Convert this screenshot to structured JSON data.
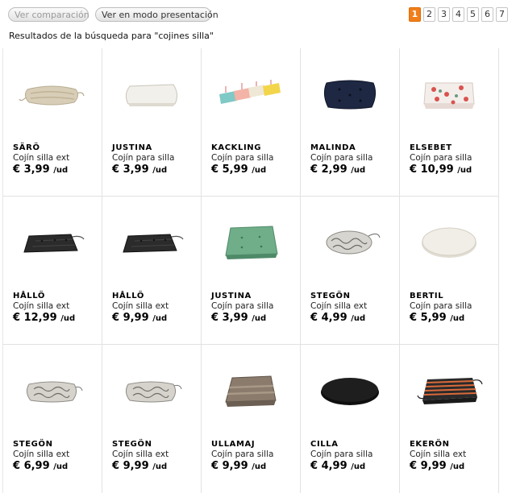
{
  "toolbar": {
    "compare_label": "Ver comparación",
    "present_label": "Ver en modo presentación"
  },
  "pagination": {
    "current": "1",
    "pages": [
      "1",
      "2",
      "3",
      "4",
      "5",
      "6",
      "7"
    ]
  },
  "results_text": "Resultados de la búsqueda para \"cojines silla\"",
  "products": [
    {
      "name": "SÄRÖ",
      "desc": "Cojín silla ext",
      "price": "€ 3,99",
      "unit": "/ud",
      "icon": "beige-striped-cushion"
    },
    {
      "name": "JUSTINA",
      "desc": "Cojín para silla",
      "price": "€ 3,99",
      "unit": "/ud",
      "icon": "white-cushion"
    },
    {
      "name": "KACKLING",
      "desc": "Cojín para silla",
      "price": "€ 5,99",
      "unit": "/ud",
      "icon": "multicolor-cushions"
    },
    {
      "name": "MALINDA",
      "desc": "Cojín para silla",
      "price": "€ 2,99",
      "unit": "/ud",
      "icon": "navy-cushion"
    },
    {
      "name": "ELSEBET",
      "desc": "Cojín para silla",
      "price": "€ 10,99",
      "unit": "/ud",
      "icon": "floral-cushion"
    },
    {
      "name": "HÅLLÖ",
      "desc": "Cojín silla ext",
      "price": "€ 12,99",
      "unit": "/ud",
      "icon": "black-cushion"
    },
    {
      "name": "HÅLLÖ",
      "desc": "Cojín silla ext",
      "price": "€ 9,99",
      "unit": "/ud",
      "icon": "black-cushion"
    },
    {
      "name": "JUSTINA",
      "desc": "Cojín para silla",
      "price": "€ 3,99",
      "unit": "/ud",
      "icon": "green-cushion"
    },
    {
      "name": "STEGÖN",
      "desc": "Cojín silla ext",
      "price": "€ 4,99",
      "unit": "/ud",
      "icon": "patterned-round-cushion"
    },
    {
      "name": "BERTIL",
      "desc": "Cojín para silla",
      "price": "€ 5,99",
      "unit": "/ud",
      "icon": "white-round-cushion"
    },
    {
      "name": "STEGÖN",
      "desc": "Cojín silla ext",
      "price": "€ 6,99",
      "unit": "/ud",
      "icon": "patterned-cushion"
    },
    {
      "name": "STEGÖN",
      "desc": "Cojín silla ext",
      "price": "€ 9,99",
      "unit": "/ud",
      "icon": "patterned-cushion"
    },
    {
      "name": "ULLAMAJ",
      "desc": "Cojín para silla",
      "price": "€ 9,99",
      "unit": "/ud",
      "icon": "brown-striped-cushion"
    },
    {
      "name": "CILLA",
      "desc": "Cojín para silla",
      "price": "€ 4,99",
      "unit": "/ud",
      "icon": "black-round-cushion"
    },
    {
      "name": "EKERÖN",
      "desc": "Cojín silla ext",
      "price": "€ 9,99",
      "unit": "/ud",
      "icon": "orange-striped-cushion"
    }
  ],
  "colors": {
    "accent": "#f07e1b",
    "grid_line": "#e2e2e2"
  }
}
